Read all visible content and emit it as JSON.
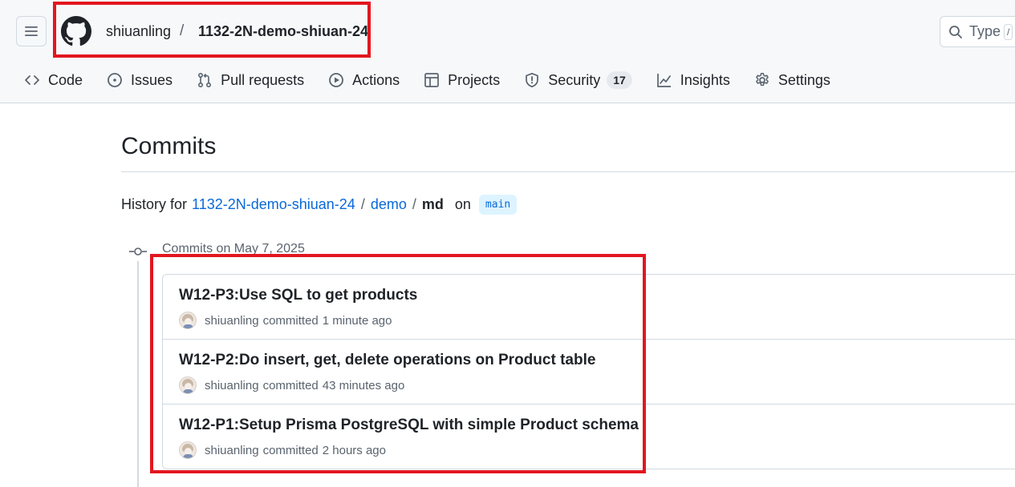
{
  "header": {
    "owner": "shiuanling",
    "separator": "/",
    "repo": "1132-2N-demo-shiuan-24",
    "search_placeholder": "Type",
    "search_key": "/"
  },
  "tabs": [
    {
      "label": "Code",
      "icon": "code-icon"
    },
    {
      "label": "Issues",
      "icon": "issue-opened-icon"
    },
    {
      "label": "Pull requests",
      "icon": "git-pull-request-icon"
    },
    {
      "label": "Actions",
      "icon": "play-icon"
    },
    {
      "label": "Projects",
      "icon": "table-icon"
    },
    {
      "label": "Security",
      "icon": "shield-icon",
      "count": "17"
    },
    {
      "label": "Insights",
      "icon": "graph-icon"
    },
    {
      "label": "Settings",
      "icon": "gear-icon"
    }
  ],
  "page": {
    "title": "Commits",
    "history_prefix": "History for",
    "path": [
      "1132-2N-demo-shiuan-24",
      "demo",
      "md"
    ],
    "on_word": "on",
    "branch": "main"
  },
  "commit_group": {
    "title": "Commits on May 7, 2025",
    "commits": [
      {
        "message": "W12-P3:Use SQL to get products",
        "author": "shiuanling",
        "verb": "committed",
        "time": "1 minute ago"
      },
      {
        "message": "W12-P2:Do insert, get, delete operations on Product table",
        "author": "shiuanling",
        "verb": "committed",
        "time": "43 minutes ago"
      },
      {
        "message": "W12-P1:Setup Prisma PostgreSQL with simple Product schema",
        "author": "shiuanling",
        "verb": "committed",
        "time": "2 hours ago"
      }
    ]
  },
  "colors": {
    "accent_link": "#0969da",
    "highlight_box": "#e3161f",
    "header_bg": "#f6f8fa"
  }
}
